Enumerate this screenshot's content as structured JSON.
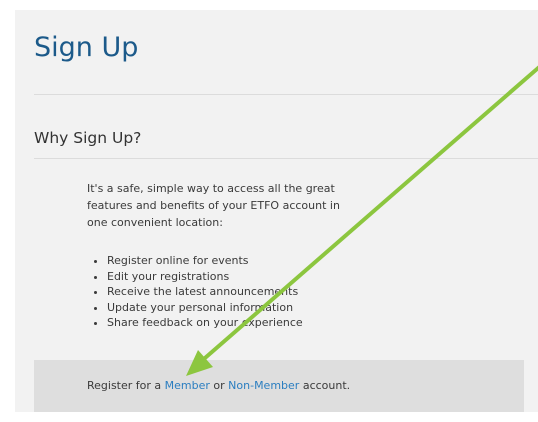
{
  "page": {
    "title": "Sign Up"
  },
  "why": {
    "heading": "Why Sign Up?",
    "intro": "It's a safe, simple way to access all the great features and benefits of your ETFO account in one convenient location:",
    "benefits": [
      "Register online for events",
      "Edit your registrations",
      "Receive the latest announcements",
      "Update your personal information",
      "Share feedback on your experience"
    ]
  },
  "register": {
    "prefix": "Register for a",
    "member_link": "Member",
    "connector": "or",
    "nonmember_link": "Non-Member",
    "suffix": "account."
  },
  "colors": {
    "title": "#1c5a8a",
    "link": "#2b7ec0",
    "arrow": "#8cc63f",
    "panel_bg": "#f2f2f2",
    "register_bg": "#dedede"
  }
}
